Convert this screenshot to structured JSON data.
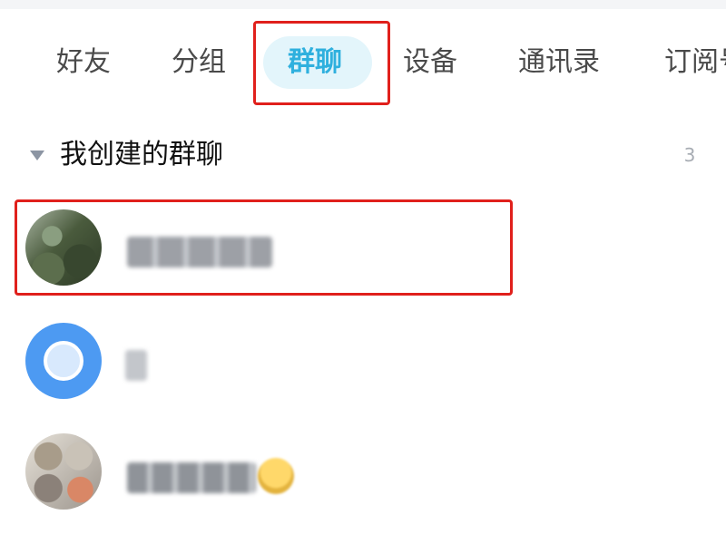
{
  "tabs": [
    {
      "label": "好友",
      "active": false
    },
    {
      "label": "分组",
      "active": false
    },
    {
      "label": "群聊",
      "active": true
    },
    {
      "label": "设备",
      "active": false
    },
    {
      "label": "通讯录",
      "active": false
    },
    {
      "label": "订阅号",
      "active": false
    }
  ],
  "section": {
    "title": "我创建的群聊",
    "count": "3",
    "expanded": true
  },
  "groups": [
    {
      "avatar": "group-avatar-photo",
      "name_visible": false
    },
    {
      "avatar": "group-avatar-blue-circle",
      "name_visible": false
    },
    {
      "avatar": "group-avatar-collage",
      "name_visible": false,
      "has_emoji": true
    }
  ],
  "colors": {
    "accent": "#2fb0de",
    "active_tab_background": "#e3f5fb",
    "highlight_border": "#e0201c",
    "text_primary": "#111111",
    "text_secondary": "#a7acb3"
  }
}
